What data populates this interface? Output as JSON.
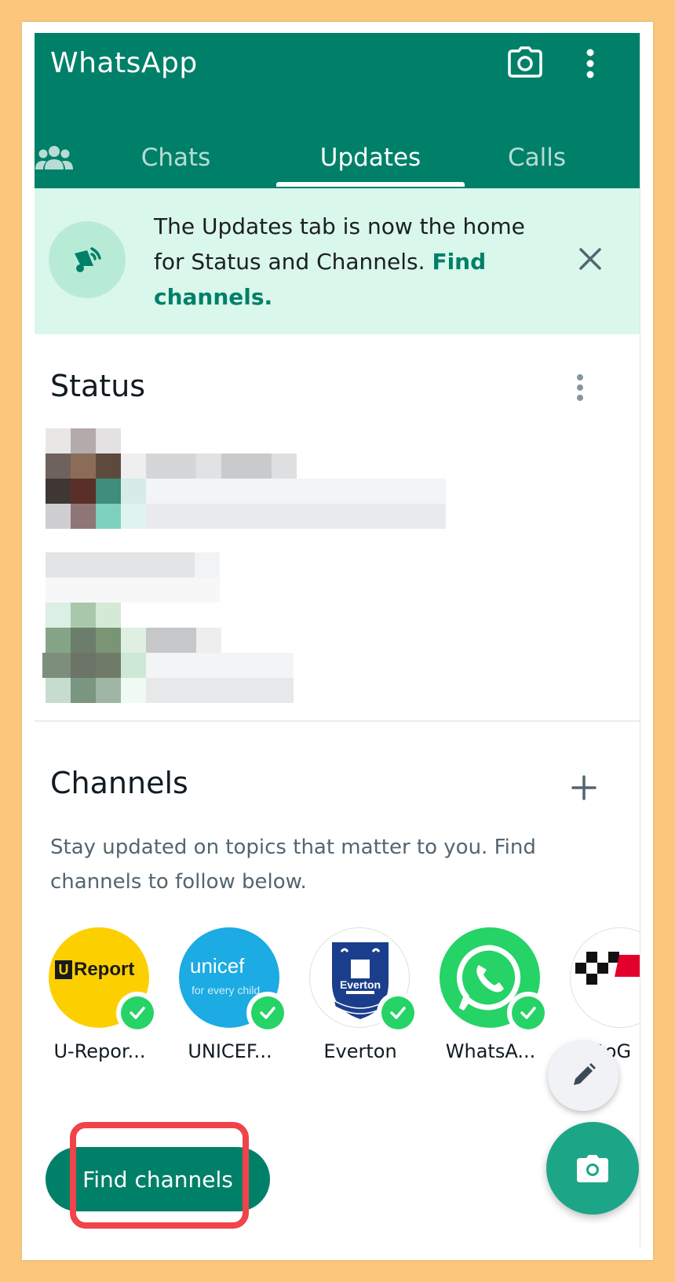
{
  "app": {
    "title": "WhatsApp"
  },
  "tabs": [
    {
      "label": "Chats"
    },
    {
      "label": "Updates"
    },
    {
      "label": "Calls"
    }
  ],
  "banner": {
    "text": "The Updates tab is now the home for Status and Channels.",
    "link": "Find channels."
  },
  "status": {
    "title": "Status"
  },
  "channels": {
    "title": "Channels",
    "description": "Stay updated on topics that matter to you. Find channels to follow below.",
    "items": [
      {
        "name": "U-Repor...",
        "avatar_text": "Report"
      },
      {
        "name": "UNICEF...",
        "avatar_text": "unicef",
        "avatar_sub": "for every child"
      },
      {
        "name": "Everton",
        "avatar_text": "Everton"
      },
      {
        "name": "WhatsA..."
      },
      {
        "name": "MotoG"
      }
    ],
    "find_button": "Find channels"
  },
  "colors": {
    "primary": "#008069",
    "banner_bg": "#daf7ec",
    "verified": "#25d366",
    "highlight": "#f0434a",
    "page_bg": "#fcc77d"
  }
}
